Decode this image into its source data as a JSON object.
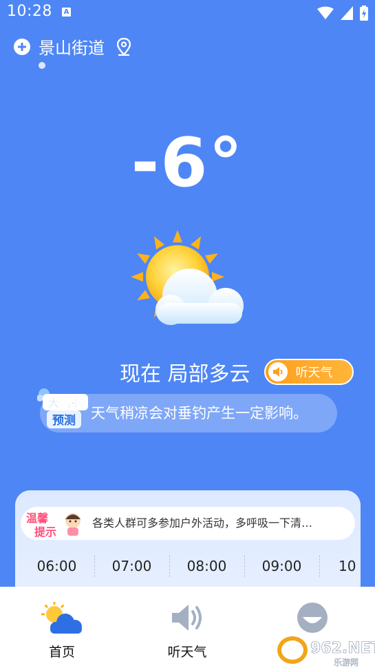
{
  "status_bar": {
    "time": "10:28",
    "notif_letter": "A"
  },
  "location": {
    "name": "景山街道"
  },
  "current": {
    "temperature": "-6°",
    "condition": "现在 局部多云"
  },
  "listen_button": {
    "label": "听天气"
  },
  "bigdata_tip": {
    "badge_line1": "大数据",
    "badge_line2": "预测",
    "text": "天气稍凉会对垂钓产生一定影响。"
  },
  "warm_tip": {
    "badge_line1": "温馨",
    "badge_line2": "提示",
    "text": "各类人群可多参加户外活动，多呼吸一下清…"
  },
  "hours": [
    "06:00",
    "07:00",
    "08:00",
    "09:00",
    "10"
  ],
  "nav": [
    {
      "label": "首页",
      "icon": "sun-cloud-icon"
    },
    {
      "label": "听天气",
      "icon": "speaker-icon"
    },
    {
      "label": "",
      "icon": "face-icon"
    }
  ],
  "watermark": {
    "text": "962.NET",
    "sub": "乐游网"
  },
  "colors": {
    "background": "#4e86f5",
    "accent_orange": "#ff9e1b"
  }
}
